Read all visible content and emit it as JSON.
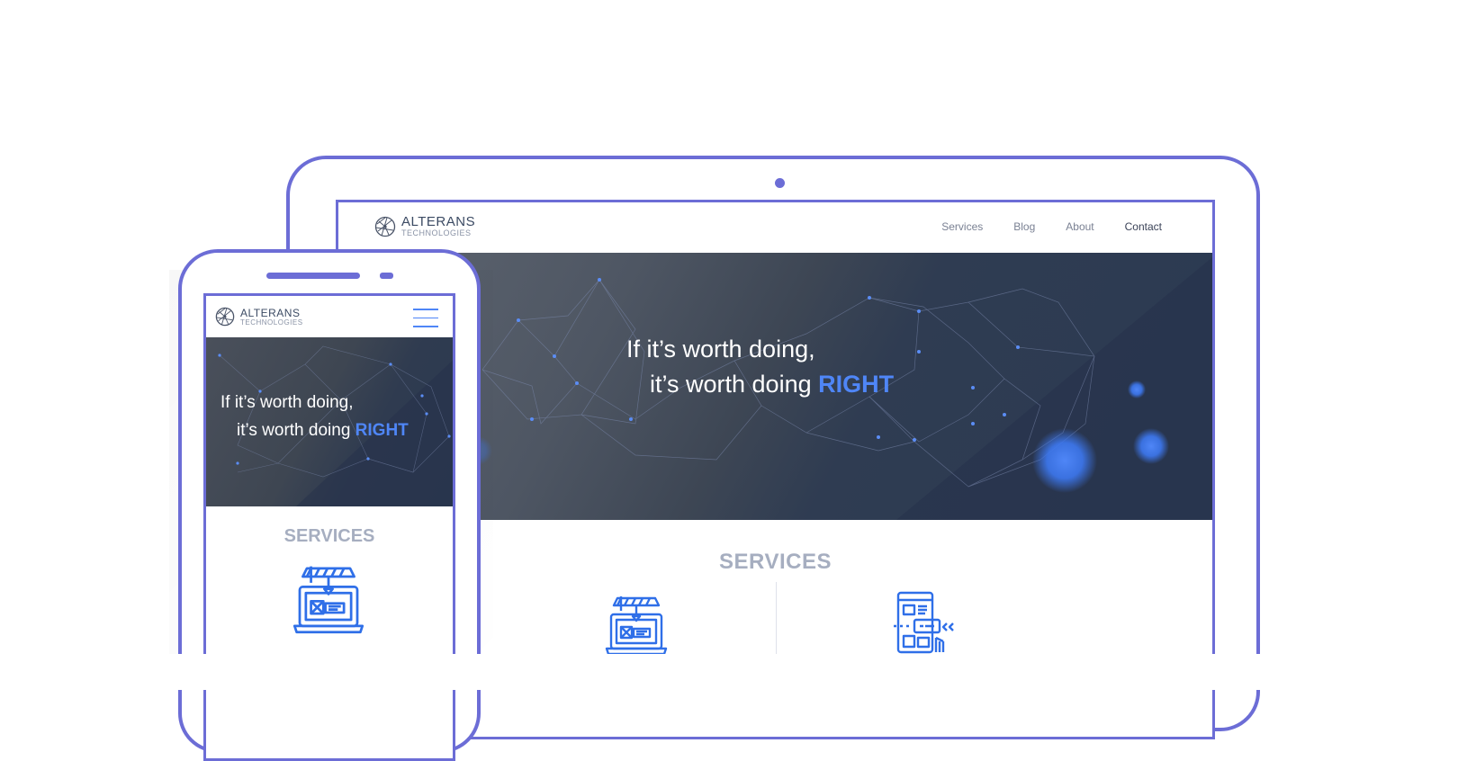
{
  "colors": {
    "frame": "#6c6dd6",
    "accent": "#4f86f7",
    "services_heading": "#a6aec0",
    "hero_dark": "#2b3a52"
  },
  "brand": {
    "name": "ALTERANS",
    "subtitle": "TECHNOLOGIES",
    "logo_icon": "globe-network-icon"
  },
  "tablet": {
    "nav": [
      "Services",
      "Blog",
      "About",
      "Contact"
    ],
    "hero": {
      "line1": "If it’s worth doing,",
      "line2_prefix": "it’s worth doing ",
      "line2_accent": "RIGHT"
    },
    "services_title": "SERVICES",
    "service_icons": [
      "laptop-construction-icon",
      "web-layout-icon"
    ]
  },
  "phone": {
    "menu_icon": "hamburger-menu-icon",
    "hero": {
      "line1": "If it’s worth doing,",
      "line2_prefix": "it’s worth doing ",
      "line2_accent": "RIGHT"
    },
    "services_title": "SERVICES",
    "service_icons": [
      "laptop-construction-icon"
    ]
  }
}
